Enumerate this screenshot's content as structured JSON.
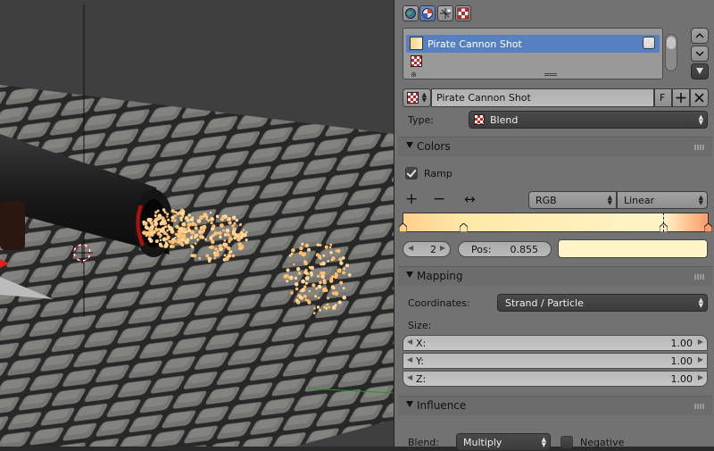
{
  "properties": {
    "slot_list": {
      "items": [
        {
          "label": "Pirate Cannon Shot",
          "enabled": true
        },
        {
          "label": ""
        }
      ]
    },
    "texture_block": {
      "name": "Pirate Cannon Shot",
      "fake_user": "F"
    },
    "type": {
      "label": "Type:",
      "value": "Blend"
    },
    "colors": {
      "title": "Colors",
      "ramp_label": "Ramp",
      "ramp_enabled": true,
      "color_mode": "RGB",
      "interpolation": "Linear",
      "active_index": "2",
      "pos_label": "Pos:",
      "pos_value": "0.855",
      "active_color": "#fff4c8",
      "stops": [
        {
          "pos": 0.0,
          "color": "#ffd08a"
        },
        {
          "pos": 0.2,
          "color": "#ffe8a8"
        },
        {
          "pos": 0.855,
          "color": "#fff4c8"
        },
        {
          "pos": 1.0,
          "color": "#ff9a6a"
        }
      ]
    },
    "mapping": {
      "title": "Mapping",
      "coordinates_label": "Coordinates:",
      "coordinates_value": "Strand / Particle",
      "size_label": "Size:",
      "x_label": "X:",
      "x_value": "1.00",
      "y_label": "Y:",
      "y_value": "1.00",
      "z_label": "Z:",
      "z_value": "1.00"
    },
    "influence": {
      "title": "Influence",
      "blend_label": "Blend:",
      "blend_value": "Multiply",
      "negative_label": "Negative"
    }
  },
  "colors": {
    "panel_bg": "#727272",
    "highlight": "#5680c2",
    "accent": "#ffd89a"
  }
}
